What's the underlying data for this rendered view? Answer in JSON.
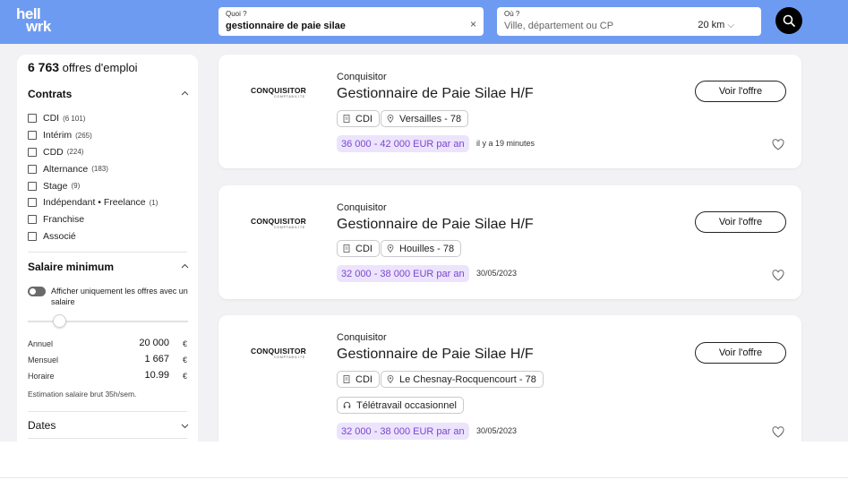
{
  "brand": {
    "logo_line1": "hell",
    "logo_line2": "wrk"
  },
  "search": {
    "what_label": "Quoi ?",
    "what_value": "gestionnaire de paie silae",
    "clear_icon": "×",
    "where_label": "Où ?",
    "where_placeholder": "Ville, département ou CP",
    "radius": "20 km",
    "radius_chevron": "⌵"
  },
  "sidebar": {
    "count": "6 763",
    "count_suffix": "offres d'emploi",
    "contracts_title": "Contrats",
    "contracts": [
      {
        "label": "CDI",
        "count": "(6 101)"
      },
      {
        "label": "Intérim",
        "count": "(265)"
      },
      {
        "label": "CDD",
        "count": "(224)"
      },
      {
        "label": "Alternance",
        "count": "(183)"
      },
      {
        "label": "Stage",
        "count": "(9)"
      },
      {
        "label": "Indépendant • Freelance",
        "count": "(1)"
      },
      {
        "label": "Franchise",
        "count": ""
      },
      {
        "label": "Associé",
        "count": ""
      }
    ],
    "salary_title": "Salaire minimum",
    "salary_toggle_text": "Afficher uniquement les offres avec un salaire",
    "salary_slider_level": 0.2,
    "salary_rows": [
      {
        "label": "Annuel",
        "value": "20 000",
        "currency": "€"
      },
      {
        "label": "Mensuel",
        "value": "1 667",
        "currency": "€"
      },
      {
        "label": "Horaire",
        "value": "10.99",
        "currency": "€"
      }
    ],
    "salary_note": "Estimation salaire brut 35h/sem.",
    "dates_title": "Dates"
  },
  "jobs": [
    {
      "logo_text": "CONQUISITOR",
      "logo_subtext": "COMPTABILITE",
      "company": "Conquisitor",
      "title": "Gestionnaire de Paie Silae H/F",
      "contract": "CDI",
      "location": "Versailles - 78",
      "salary": "36 000 - 42 000 EUR par an",
      "date": "il y a 19 minutes",
      "button": "Voir l'offre"
    },
    {
      "logo_text": "CONQUISITOR",
      "logo_subtext": "COMPTABILITE",
      "company": "Conquisitor",
      "title": "Gestionnaire de Paie Silae H/F",
      "contract": "CDI",
      "location": "Houilles - 78",
      "salary": "32 000 - 38 000 EUR par an",
      "date": "30/05/2023",
      "button": "Voir l'offre"
    },
    {
      "logo_text": "CONQUISITOR",
      "logo_subtext": "COMPTABILITE",
      "company": "Conquisitor",
      "title": "Gestionnaire de Paie Silae H/F",
      "contract": "CDI",
      "location": "Le Chesnay-Rocquencourt - 78",
      "remote": "Télétravail occasionnel",
      "salary": "32 000 - 38 000 EUR par an",
      "date": "30/05/2023",
      "button": "Voir l'offre"
    }
  ],
  "colors": {
    "header_bg": "#6e9bf2",
    "page_bg": "#f2f2f4",
    "salary_badge_bg": "#ece4fd",
    "salary_badge_text": "#7a45cf"
  },
  "icons": {
    "search_button": "search-icon",
    "contract_tag": "document-icon",
    "location_tag": "location-pin-icon",
    "remote_tag": "headset-icon",
    "favorite": "heart-icon",
    "collapse": "chevron-up-icon",
    "expand": "chevron-down-icon"
  }
}
